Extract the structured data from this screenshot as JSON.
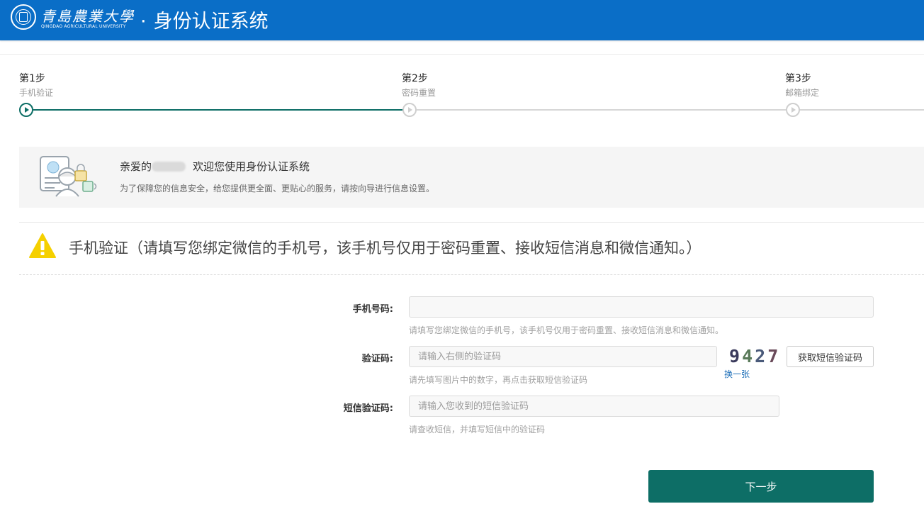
{
  "header": {
    "logo_cn": "青島農業大學",
    "logo_en": "QINGDAO AGRICULTURAL UNIVERSITY",
    "separator": "·",
    "system_title": "身份认证系统"
  },
  "steps": [
    {
      "title": "第1步",
      "subtitle": "手机验证",
      "state": "active"
    },
    {
      "title": "第2步",
      "subtitle": "密码重置",
      "state": "pending"
    },
    {
      "title": "第3步",
      "subtitle": "邮箱绑定",
      "state": "pending"
    }
  ],
  "welcome": {
    "greeting_prefix": "亲爱的",
    "greeting_suffix": "欢迎您使用身份认证系统",
    "description": "为了保障您的信息安全，给您提供更全面、更贴心的服务，请按向导进行信息设置。"
  },
  "notice": {
    "text": "手机验证（请填写您绑定微信的手机号，该手机号仅用于密码重置、接收短信消息和微信通知。）"
  },
  "form": {
    "phone": {
      "label": "手机号码:",
      "value": "",
      "placeholder": "",
      "hint": "请填写您绑定微信的手机号，该手机号仅用于密码重置、接收短信消息和微信通知。"
    },
    "captcha": {
      "label": "验证码:",
      "value": "",
      "placeholder": "请输入右侧的验证码",
      "hint": "请先填写图片中的数字，再点击获取短信验证码",
      "image_digits": [
        "9",
        "4",
        "2",
        "7"
      ],
      "refresh_label": "换一张",
      "sms_button_label": "获取短信验证码"
    },
    "sms": {
      "label": "短信验证码:",
      "value": "",
      "placeholder": "请输入您收到的短信验证码",
      "hint": "请查收短信，并填写短信中的验证码"
    },
    "next_button_label": "下一步"
  },
  "colors": {
    "header_bg": "#0a6ec7",
    "primary": "#0d6e66",
    "warning": "#f5d000",
    "link": "#1d6fb8"
  }
}
